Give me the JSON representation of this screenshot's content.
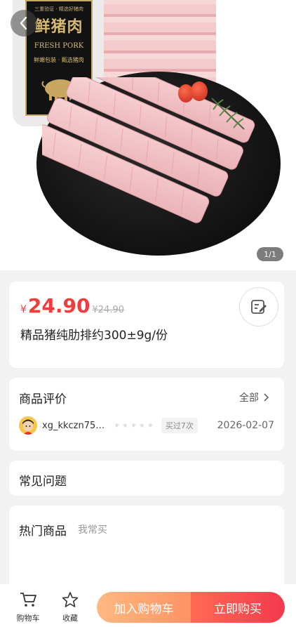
{
  "hero": {
    "label_small_top": "三重验证 · 精选好猪肉",
    "label_cn": "鲜猪肉",
    "label_en": "FRESH PORK",
    "label_sub": "鲜嫩包装 · 甄选猪肉",
    "image_counter": "1/1"
  },
  "product": {
    "currency": "¥",
    "price": "24.90",
    "original_price": "¥24.90",
    "title": "精品猪纯肋排约300±9g/份"
  },
  "reviews": {
    "title": "商品评价",
    "see_all": "全部",
    "reviewer": "xg_kkczn75…",
    "badge": "买过7次",
    "date": "2026-02-07",
    "rating": 0
  },
  "faq": {
    "title": "常见问题"
  },
  "hot": {
    "title": "热门商品",
    "subtitle": "我常买"
  },
  "bottom_bar": {
    "cart_label": "购物车",
    "fav_label": "收藏",
    "add_to_cart": "加入购物车",
    "buy_now": "立即购买"
  },
  "colors": {
    "price": "#f23b3b",
    "buy": "#f4394d",
    "cart": "#ff9266"
  }
}
